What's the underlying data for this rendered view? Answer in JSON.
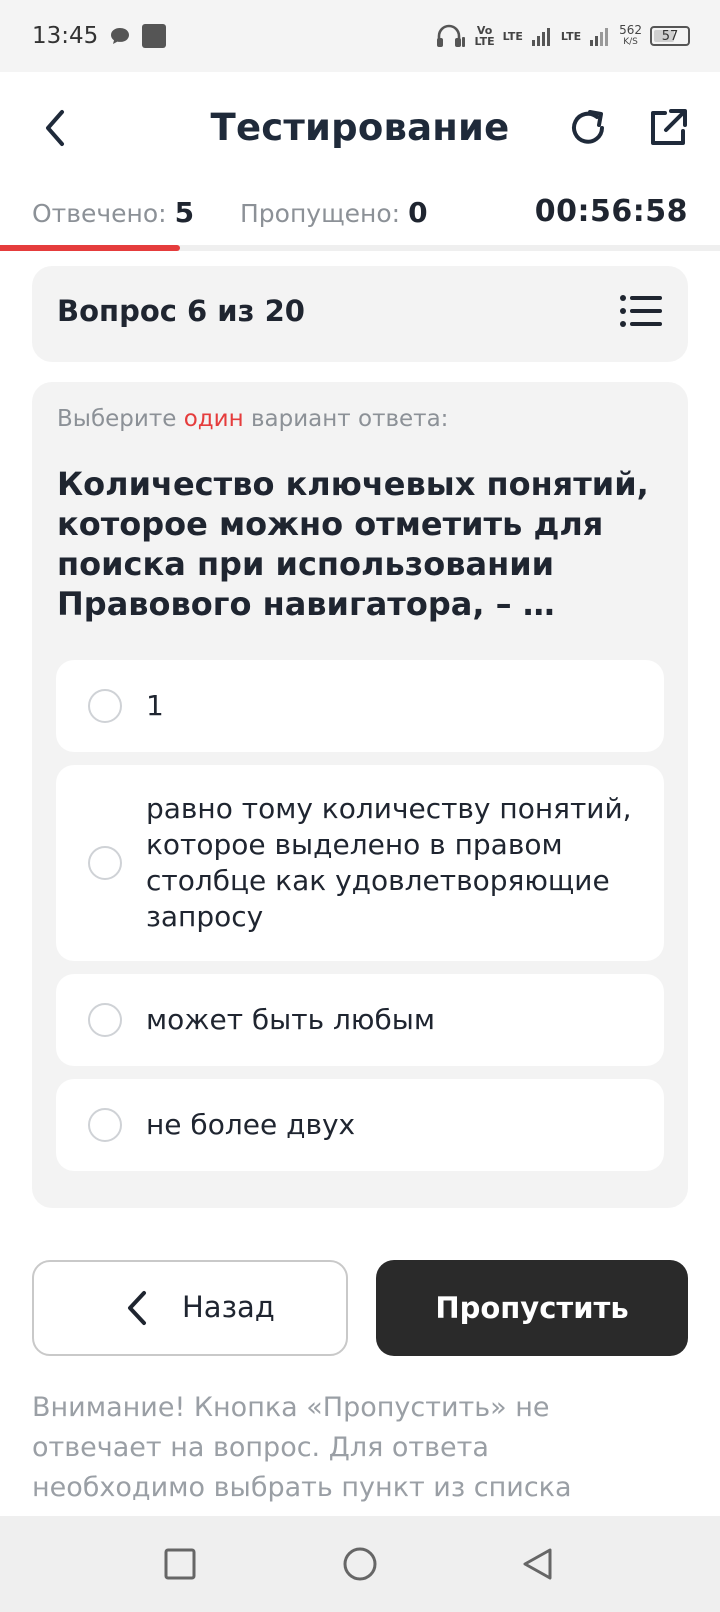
{
  "status_bar": {
    "time": "13:45",
    "volte": [
      "Vo",
      "LTE"
    ],
    "net1": "LTE",
    "net2": "LTE",
    "speed_value": "562",
    "speed_unit": "K/S",
    "battery": "57"
  },
  "header": {
    "title": "Тестирование"
  },
  "stats": {
    "answered_label": "Отвечено:",
    "answered_value": "5",
    "skipped_label": "Пропущено:",
    "skipped_value": "0",
    "timer": "00:56:58",
    "progress_fraction": 0.25
  },
  "question": {
    "counter": "Вопрос 6 из 20",
    "instruction_prefix": "Выберите",
    "instruction_highlight": "один",
    "instruction_suffix": "вариант ответа:",
    "text": "Количество ключевых понятий, которое можно отметить для поиска при использовании Правового навигатора, – …",
    "options": [
      "1",
      "равно тому количеству понятий, которое выделено в правом столбце как удовлетворяющие запросу",
      "может быть любым",
      "не более двух"
    ]
  },
  "buttons": {
    "back": "Назад",
    "skip": "Пропустить"
  },
  "notice": "Внимание! Кнопка «Пропустить» не отвечает на вопрос. Для ответа необходимо выбрать пункт из списка",
  "colors": {
    "accent": "#e53c3c",
    "dark_button": "#2a2a2a",
    "card_bg": "#f3f3f3"
  }
}
